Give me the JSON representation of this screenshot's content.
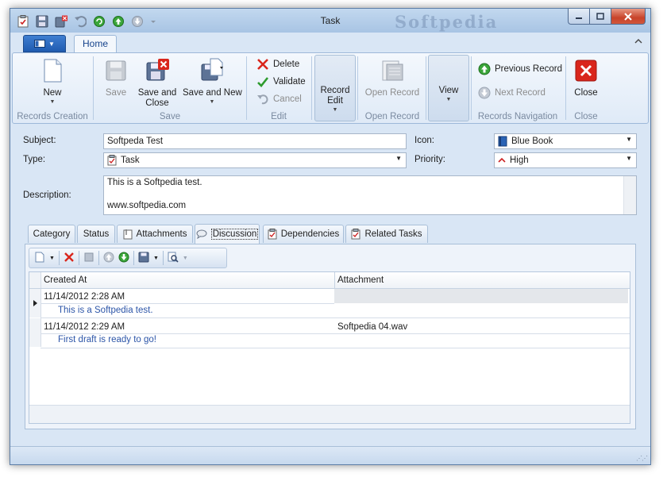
{
  "window": {
    "title": "Task",
    "watermark": "Softpedia"
  },
  "ribbon": {
    "tabs": [
      "Home"
    ],
    "groups": {
      "records_creation": {
        "label": "Records Creation",
        "new_label": "New"
      },
      "save": {
        "label": "Save",
        "save_label": "Save",
        "save_close_label": "Save and\nClose",
        "save_new_label": "Save and New"
      },
      "edit": {
        "label": "Edit",
        "delete_label": "Delete",
        "validate_label": "Validate",
        "cancel_label": "Cancel"
      },
      "record_edit": {
        "label": "Record\nEdit"
      },
      "open_record": {
        "label": "Open Record",
        "button_label": "Open Record"
      },
      "view": {
        "label": "View"
      },
      "records_navigation": {
        "label": "Records Navigation",
        "previous_label": "Previous Record",
        "next_label": "Next Record"
      },
      "close": {
        "label": "Close",
        "button_label": "Close"
      }
    }
  },
  "form": {
    "subject_label": "Subject:",
    "subject_value": "Softpeda Test",
    "icon_label": "Icon:",
    "icon_value": "Blue Book",
    "type_label": "Type:",
    "type_value": "Task",
    "priority_label": "Priority:",
    "priority_value": "High",
    "description_label": "Description:",
    "description_line1": "This is a Softpedia test.",
    "description_line2": "www.softpedia.com"
  },
  "tabs": [
    {
      "label": "Category"
    },
    {
      "label": "Status"
    },
    {
      "label": "Attachments"
    },
    {
      "label": "Discussion"
    },
    {
      "label": "Dependencies"
    },
    {
      "label": "Related Tasks"
    }
  ],
  "discussion": {
    "columns": [
      "Created At",
      "Attachment"
    ],
    "rows": [
      {
        "created_at": "11/14/2012 2:28 AM",
        "attachment": "",
        "preview": "This is a Softpedia test."
      },
      {
        "created_at": "11/14/2012 2:29 AM",
        "attachment": "Softpedia 04.wav",
        "preview": "First draft is ready to go!"
      }
    ]
  },
  "colors": {
    "accent": "#15428b",
    "window_bg": "#d9e6f5",
    "close_red": "#c7432a",
    "delete_red": "#d9261c",
    "validate_green": "#2e9b2e",
    "link_blue": "#2c55a8"
  }
}
